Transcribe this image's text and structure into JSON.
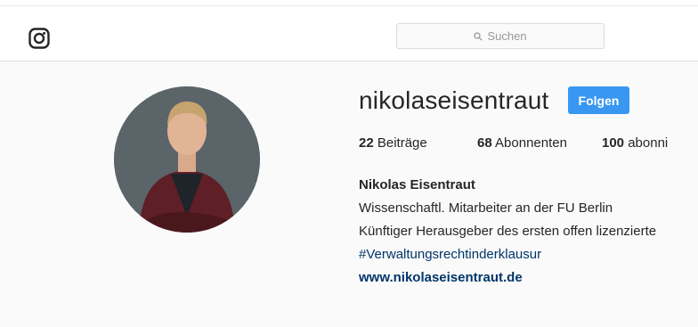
{
  "header": {
    "logo_icon": "instagram-icon",
    "search_placeholder": "Suchen",
    "search_icon": "search-icon"
  },
  "profile": {
    "username": "nikolaseisentraut",
    "follow_label": "Folgen",
    "stats": {
      "posts_count": "22",
      "posts_label": "Beiträge",
      "followers_count": "68",
      "followers_label": "Abonnenten",
      "following_count": "100",
      "following_label": "abonni"
    },
    "full_name": "Nikolas Eisentraut",
    "bio_line1": "Wissenschaftl. Mitarbeiter an der FU Berlin",
    "bio_line2": "Künftiger Herausgeber des ersten offen lizenzierte",
    "hashtag": "#Verwaltungsrechtinderklausur",
    "website": "www.nikolaseisentraut.de"
  },
  "colors": {
    "accent": "#3897f0",
    "link": "#003569",
    "background": "#fafafa"
  }
}
